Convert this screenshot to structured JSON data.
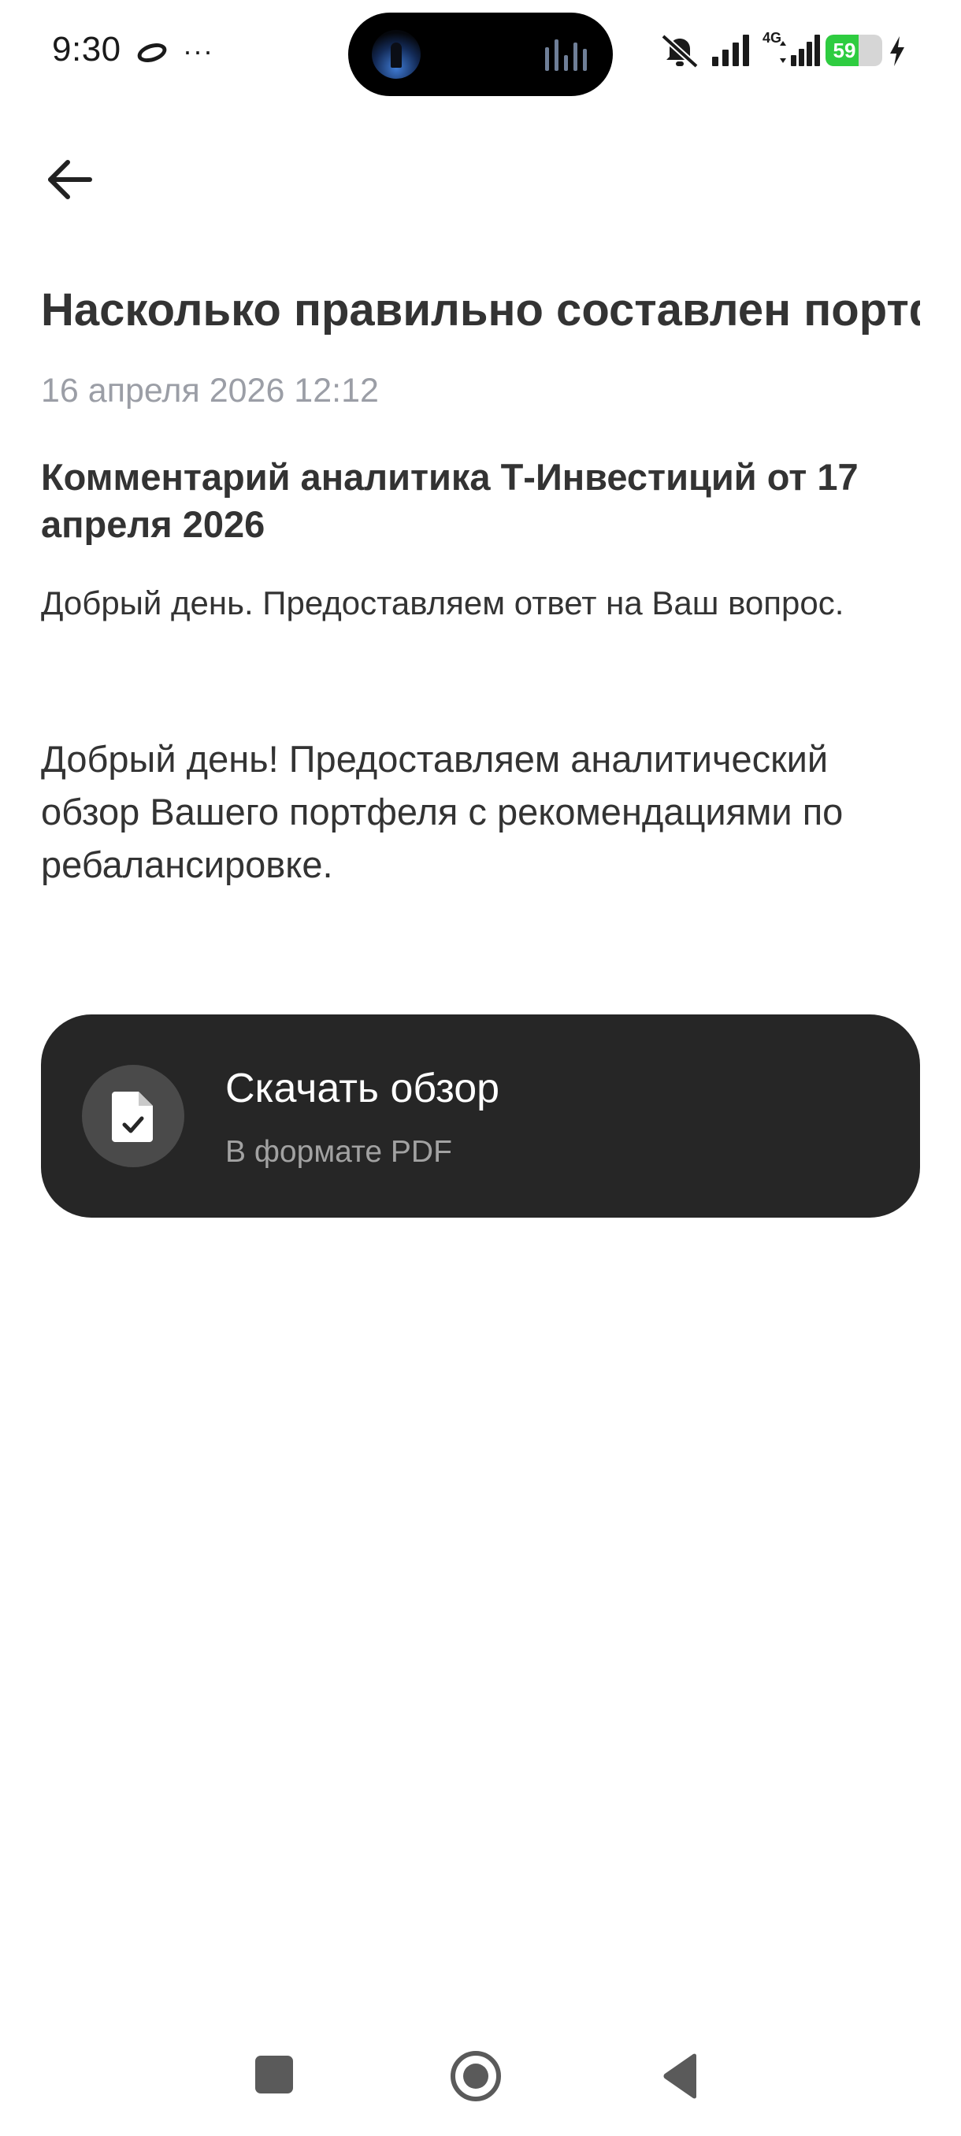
{
  "status_bar": {
    "time": "9:30",
    "more_indicator": "···",
    "network_type": "4G",
    "battery_level": "59",
    "battery_fraction": 0.59
  },
  "article": {
    "title": "Насколько правильно составлен портфель с точки зрения риск/дохо",
    "date": "16 апреля 2026 12:12",
    "analyst_heading": "Комментарий аналитика Т-Инвестиций от 17 апреля 2026",
    "intro": "Добрый день. Предоставляем ответ на Ваш вопрос.",
    "review_text": "Добрый день! Предоставляем аналитический обзор Вашего портфеля с рекомендациями по ребалансировке."
  },
  "download_card": {
    "title": "Скачать обзор",
    "subtitle": "В формате PDF",
    "icon": "file-check-icon"
  },
  "navigation": {
    "back_icon": "arrow-left-icon",
    "system_buttons": [
      "recents-square-icon",
      "home-circle-icon",
      "back-triangle-icon"
    ]
  }
}
